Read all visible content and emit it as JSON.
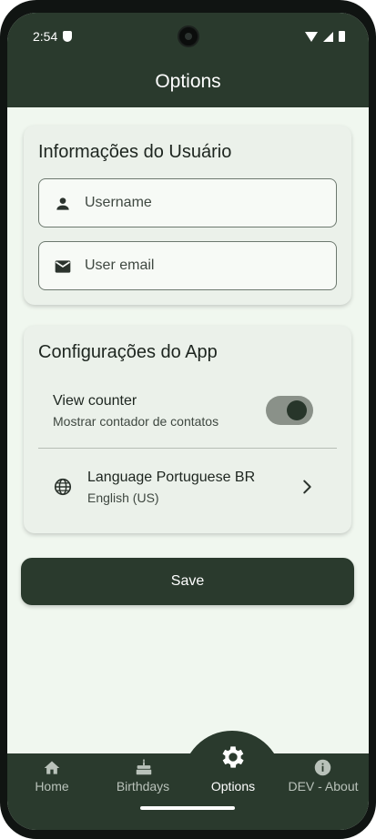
{
  "status_bar": {
    "time": "2:54"
  },
  "app_bar": {
    "title": "Options"
  },
  "user_card": {
    "title": "Informações do Usuário",
    "username_placeholder": "Username",
    "email_placeholder": "User email"
  },
  "app_card": {
    "title": "Configurações do App",
    "view_counter": {
      "title": "View counter",
      "subtitle": "Mostrar contador de contatos",
      "enabled": true
    },
    "language": {
      "title": "Language Portuguese BR",
      "subtitle": "English (US)"
    }
  },
  "save_label": "Save",
  "nav": {
    "items": [
      {
        "label": "Home",
        "icon": "home-icon",
        "active": false
      },
      {
        "label": "Birthdays",
        "icon": "cake-icon",
        "active": false
      },
      {
        "label": "Options",
        "icon": "gear-icon",
        "active": true
      },
      {
        "label": "DEV - About",
        "icon": "info-icon",
        "active": false
      }
    ]
  },
  "colors": {
    "primary": "#2a3a2d",
    "background": "#f0f7ef",
    "card": "#ebf1ea"
  }
}
